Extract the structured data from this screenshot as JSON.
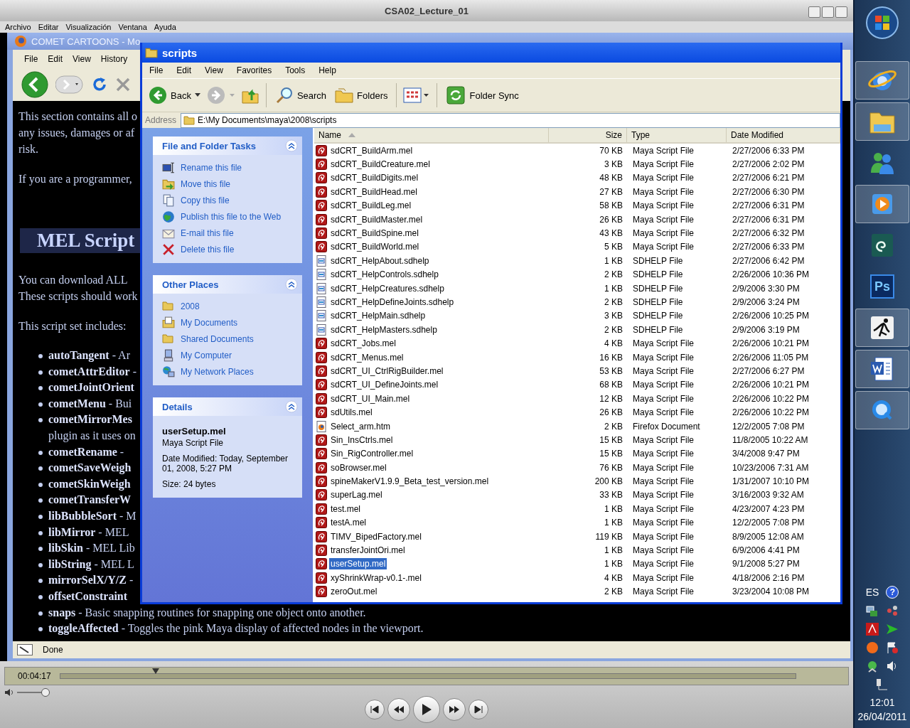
{
  "player": {
    "title": "CSA02_Lecture_01",
    "menu": [
      "Archivo",
      "Editar",
      "Visualización",
      "Ventana",
      "Ayuda"
    ],
    "time": "00:04:17",
    "position": {
      "level": 0.13
    },
    "volume": {
      "level": 0.9
    }
  },
  "firefox": {
    "title": "COMET CARTOONS - Mo",
    "menu": [
      "File",
      "Edit",
      "View",
      "History"
    ],
    "paragraphs": [
      "This section contains all o",
      "any issues, damages or af",
      "risk."
    ],
    "programmer": "If you are a programmer,",
    "heading": "MEL Script",
    "download": [
      "You can download ALL",
      "These scripts should work"
    ],
    "includes": "This script set includes:",
    "items": [
      {
        "text": "**autoTangent** - Ar"
      },
      {
        "text": "**cometAttrEditor** -"
      },
      {
        "text": "**cometJointOrient**"
      },
      {
        "text": "**cometMenu** - Bui"
      },
      {
        "text": "**cometMirrorMes**",
        "continuation": "plugin as it uses on"
      },
      {
        "text": "**cometRename** - "
      },
      {
        "text": "**cometSaveWeigh**"
      },
      {
        "text": "**cometSkinWeigh**"
      },
      {
        "text": "**cometTransferW**"
      },
      {
        "text": "**libBubbleSort** - M"
      },
      {
        "text": "**libMirror** - MEL"
      },
      {
        "text": "**libSkin** - MEL Lib"
      },
      {
        "text": "**libString** - MEL L"
      },
      {
        "text": "**mirrorSelX/Y/Z** -"
      },
      {
        "text": "**offsetConstraint**"
      },
      {
        "text": "**snaps** - Basic snapping routines for snapping one object onto another."
      },
      {
        "text": "**toggleAffected** - Toggles the pink Maya display of affected nodes in the viewport."
      }
    ],
    "status": "Done"
  },
  "explorer": {
    "title": "scripts",
    "menu": [
      "File",
      "Edit",
      "View",
      "Favorites",
      "Tools",
      "Help"
    ],
    "toolbar": {
      "back": "Back",
      "search": "Search",
      "folders": "Folders",
      "sync": "Folder Sync"
    },
    "address_label": "Address",
    "address": "E:\\My Documents\\maya\\2008\\scripts",
    "tasks": {
      "title": "File and Folder Tasks",
      "items": [
        {
          "label": "Rename this file",
          "kind": "rename"
        },
        {
          "label": "Move this file",
          "kind": "move"
        },
        {
          "label": "Copy this file",
          "kind": "copy"
        },
        {
          "label": "Publish this file to the Web",
          "kind": "publish"
        },
        {
          "label": "E-mail this file",
          "kind": "email"
        },
        {
          "label": "Delete this file",
          "kind": "delete"
        }
      ]
    },
    "places": {
      "title": "Other Places",
      "items": [
        {
          "label": "2008",
          "kind": "folder"
        },
        {
          "label": "My Documents",
          "kind": "documents"
        },
        {
          "label": "Shared Documents",
          "kind": "folder"
        },
        {
          "label": "My Computer",
          "kind": "computer"
        },
        {
          "label": "My Network Places",
          "kind": "network"
        }
      ]
    },
    "details": {
      "title": "Details",
      "name": "userSetup.mel",
      "type": "Maya Script File",
      "modified": "Date Modified: Today, September 01, 2008, 5:27 PM",
      "size": "Size: 24 bytes"
    },
    "columns": [
      "Name",
      "Size",
      "Type",
      "Date Modified"
    ],
    "rows": [
      {
        "name": "sdCRT_BuildArm.mel",
        "size": "70 KB",
        "type": "Maya Script File",
        "date": "2/27/2006 6:33 PM",
        "kind": "mel",
        "selected": false
      },
      {
        "name": "sdCRT_BuildCreature.mel",
        "size": "3 KB",
        "type": "Maya Script File",
        "date": "2/27/2006 2:02 PM",
        "kind": "mel",
        "selected": false
      },
      {
        "name": "sdCRT_BuildDigits.mel",
        "size": "48 KB",
        "type": "Maya Script File",
        "date": "2/27/2006 6:21 PM",
        "kind": "mel",
        "selected": false
      },
      {
        "name": "sdCRT_BuildHead.mel",
        "size": "27 KB",
        "type": "Maya Script File",
        "date": "2/27/2006 6:30 PM",
        "kind": "mel",
        "selected": false
      },
      {
        "name": "sdCRT_BuildLeg.mel",
        "size": "58 KB",
        "type": "Maya Script File",
        "date": "2/27/2006 6:31 PM",
        "kind": "mel",
        "selected": false
      },
      {
        "name": "sdCRT_BuildMaster.mel",
        "size": "26 KB",
        "type": "Maya Script File",
        "date": "2/27/2006 6:31 PM",
        "kind": "mel",
        "selected": false
      },
      {
        "name": "sdCRT_BuildSpine.mel",
        "size": "43 KB",
        "type": "Maya Script File",
        "date": "2/27/2006 6:32 PM",
        "kind": "mel",
        "selected": false
      },
      {
        "name": "sdCRT_BuildWorld.mel",
        "size": "5 KB",
        "type": "Maya Script File",
        "date": "2/27/2006 6:33 PM",
        "kind": "mel",
        "selected": false
      },
      {
        "name": "sdCRT_HelpAbout.sdhelp",
        "size": "1 KB",
        "type": "SDHELP File",
        "date": "2/27/2006 6:42 PM",
        "kind": "help",
        "selected": false
      },
      {
        "name": "sdCRT_HelpControls.sdhelp",
        "size": "2 KB",
        "type": "SDHELP File",
        "date": "2/26/2006 10:36 PM",
        "kind": "help",
        "selected": false
      },
      {
        "name": "sdCRT_HelpCreatures.sdhelp",
        "size": "1 KB",
        "type": "SDHELP File",
        "date": "2/9/2006 3:30 PM",
        "kind": "help",
        "selected": false
      },
      {
        "name": "sdCRT_HelpDefineJoints.sdhelp",
        "size": "2 KB",
        "type": "SDHELP File",
        "date": "2/9/2006 3:24 PM",
        "kind": "help",
        "selected": false
      },
      {
        "name": "sdCRT_HelpMain.sdhelp",
        "size": "3 KB",
        "type": "SDHELP File",
        "date": "2/26/2006 10:25 PM",
        "kind": "help",
        "selected": false
      },
      {
        "name": "sdCRT_HelpMasters.sdhelp",
        "size": "2 KB",
        "type": "SDHELP File",
        "date": "2/9/2006 3:19 PM",
        "kind": "help",
        "selected": false
      },
      {
        "name": "sdCRT_Jobs.mel",
        "size": "4 KB",
        "type": "Maya Script File",
        "date": "2/26/2006 10:21 PM",
        "kind": "mel",
        "selected": false
      },
      {
        "name": "sdCRT_Menus.mel",
        "size": "16 KB",
        "type": "Maya Script File",
        "date": "2/26/2006 11:05 PM",
        "kind": "mel",
        "selected": false
      },
      {
        "name": "sdCRT_UI_CtrlRigBuilder.mel",
        "size": "53 KB",
        "type": "Maya Script File",
        "date": "2/27/2006 6:27 PM",
        "kind": "mel",
        "selected": false
      },
      {
        "name": "sdCRT_UI_DefineJoints.mel",
        "size": "68 KB",
        "type": "Maya Script File",
        "date": "2/26/2006 10:21 PM",
        "kind": "mel",
        "selected": false
      },
      {
        "name": "sdCRT_UI_Main.mel",
        "size": "12 KB",
        "type": "Maya Script File",
        "date": "2/26/2006 10:22 PM",
        "kind": "mel",
        "selected": false
      },
      {
        "name": "sdUtils.mel",
        "size": "26 KB",
        "type": "Maya Script File",
        "date": "2/26/2006 10:22 PM",
        "kind": "mel",
        "selected": false
      },
      {
        "name": "Select_arm.htm",
        "size": "2 KB",
        "type": "Firefox Document",
        "date": "12/2/2005 7:08 PM",
        "kind": "web",
        "selected": false
      },
      {
        "name": "Sin_InsCtrls.mel",
        "size": "15 KB",
        "type": "Maya Script File",
        "date": "11/8/2005 10:22 AM",
        "kind": "mel",
        "selected": false
      },
      {
        "name": "Sin_RigController.mel",
        "size": "15 KB",
        "type": "Maya Script File",
        "date": "3/4/2008 9:47 PM",
        "kind": "mel",
        "selected": false
      },
      {
        "name": "soBrowser.mel",
        "size": "76 KB",
        "type": "Maya Script File",
        "date": "10/23/2006 7:31 AM",
        "kind": "mel",
        "selected": false
      },
      {
        "name": "spineMakerV1.9.9_Beta_test_version.mel",
        "size": "200 KB",
        "type": "Maya Script File",
        "date": "1/31/2007 10:10 PM",
        "kind": "mel",
        "selected": false
      },
      {
        "name": "superLag.mel",
        "size": "33 KB",
        "type": "Maya Script File",
        "date": "3/16/2003 9:32 AM",
        "kind": "mel",
        "selected": false
      },
      {
        "name": "test.mel",
        "size": "1 KB",
        "type": "Maya Script File",
        "date": "4/23/2007 4:23 PM",
        "kind": "mel",
        "selected": false
      },
      {
        "name": "testA.mel",
        "size": "1 KB",
        "type": "Maya Script File",
        "date": "12/2/2005 7:08 PM",
        "kind": "mel",
        "selected": false
      },
      {
        "name": "TIMV_BipedFactory.mel",
        "size": "119 KB",
        "type": "Maya Script File",
        "date": "8/9/2005 12:08 AM",
        "kind": "mel",
        "selected": false
      },
      {
        "name": "transferJointOri.mel",
        "size": "1 KB",
        "type": "Maya Script File",
        "date": "6/9/2006 4:41 PM",
        "kind": "mel",
        "selected": false
      },
      {
        "name": "userSetup.mel",
        "size": "1 KB",
        "type": "Maya Script File",
        "date": "9/1/2008 5:27 PM",
        "kind": "mel",
        "selected": true
      },
      {
        "name": "xyShrinkWrap-v0.1-.mel",
        "size": "4 KB",
        "type": "Maya Script File",
        "date": "4/18/2006 2:16 PM",
        "kind": "mel",
        "selected": false
      },
      {
        "name": "zeroOut.mel",
        "size": "2 KB",
        "type": "Maya Script File",
        "date": "3/23/2004 10:08 PM",
        "kind": "mel",
        "selected": false
      }
    ]
  },
  "taskbar": {
    "apps": [
      {
        "kind": "browser",
        "selected": true
      },
      {
        "kind": "folder",
        "selected": true
      },
      {
        "kind": "messenger",
        "selected": false
      },
      {
        "kind": "media",
        "selected": true
      },
      {
        "kind": "spiral",
        "selected": false
      },
      {
        "kind": "ps",
        "label": "Ps",
        "selected": false
      },
      {
        "kind": "figure",
        "selected": true
      },
      {
        "kind": "word",
        "selected": true
      },
      {
        "kind": "quicktime",
        "selected": true
      }
    ],
    "language": "ES",
    "help": "?",
    "time": "12:01",
    "date": "26/04/2011"
  }
}
